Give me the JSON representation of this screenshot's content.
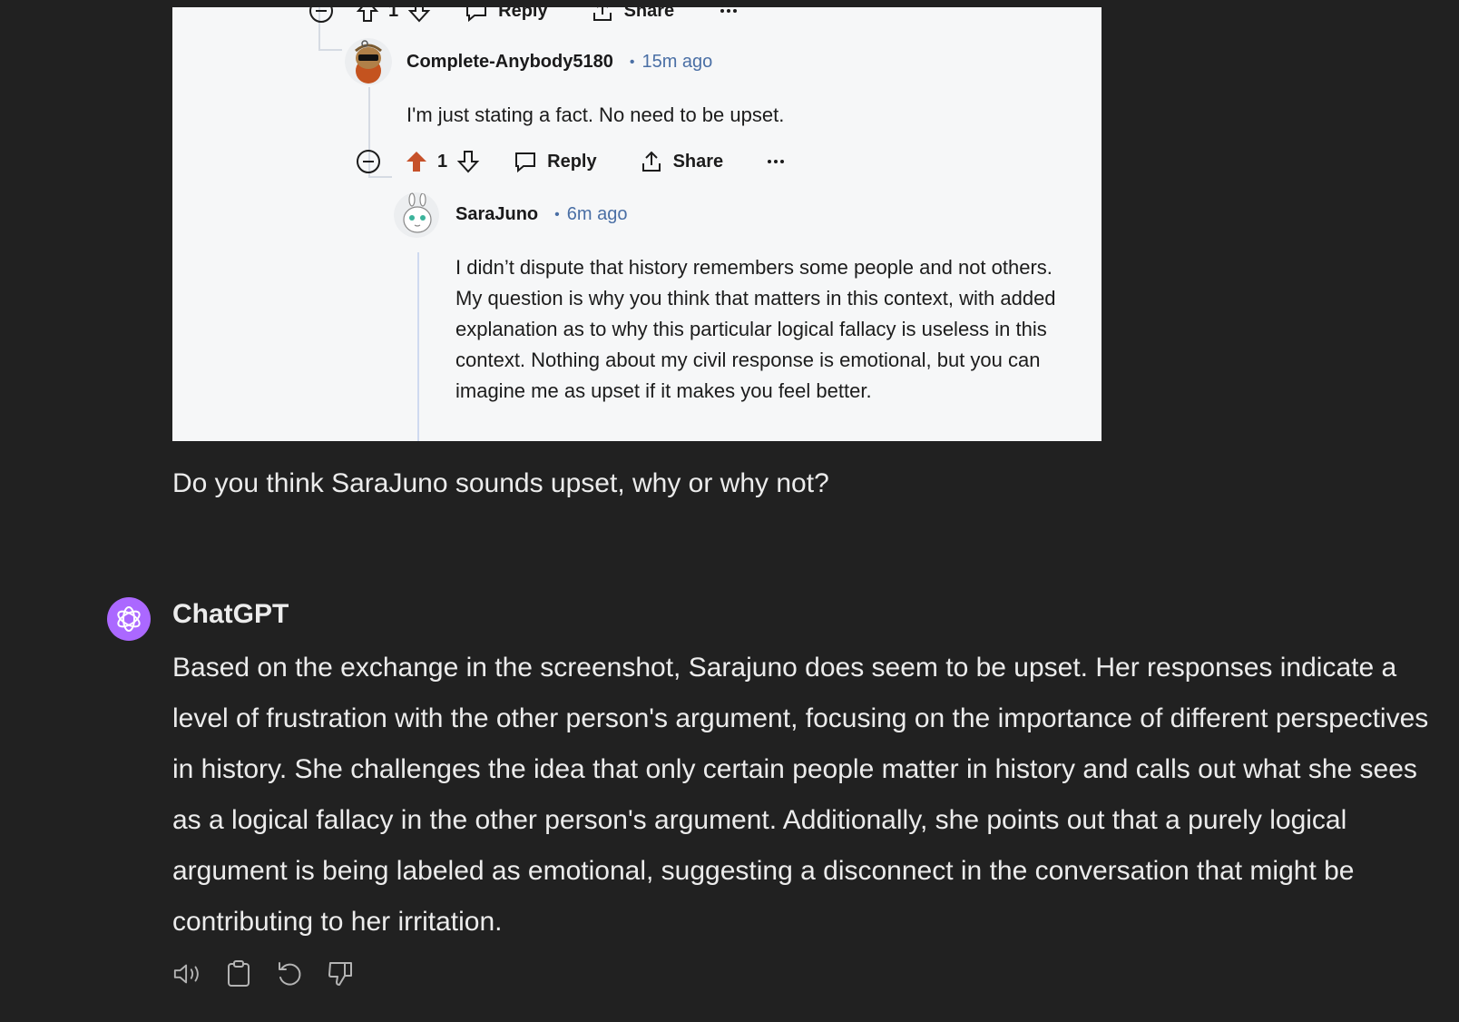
{
  "embedded_screenshot": {
    "top_actions": {
      "vote_count": "1",
      "reply_label": "Reply",
      "share_label": "Share"
    },
    "comment1": {
      "author": "Complete-Anybody5180",
      "separator": "•",
      "time": "15m ago",
      "text": "I'm just stating a fact. No need to be upset.",
      "vote_count": "1",
      "reply_label": "Reply",
      "share_label": "Share",
      "more_label": "•••"
    },
    "comment2": {
      "author": "SaraJuno",
      "separator": "•",
      "time": "6m ago",
      "text": "I didn’t dispute that history remembers some people and not others. My question is why you think that matters in this context, with added explanation as to why this particular logical fallacy is useless in this context. Nothing about my civil response is emotional, but you can imagine me as upset if it makes you feel better."
    },
    "colors": {
      "upvote_active": "#c6512a",
      "link_blue": "#4a6fa5"
    }
  },
  "prompt": "Do you think SaraJuno sounds upset, why or why not?",
  "assistant": {
    "name": "ChatGPT",
    "avatar_color": "#ab68ff",
    "response": "Based on the exchange in the screenshot, Sarajuno does seem to be upset. Her responses indicate a level of frustration with the other person's argument, focusing on the importance of different perspectives in history. She challenges the idea that only certain people matter in history and calls out what she sees as a logical fallacy in the other person's argument. Additionally, she points out that a purely logical argument is being labeled as emotional, suggesting a disconnect in the conversation that might be contributing to her irritation."
  },
  "toolbar_icons": [
    "read-aloud-icon",
    "copy-icon",
    "regenerate-icon",
    "thumbs-down-icon"
  ]
}
